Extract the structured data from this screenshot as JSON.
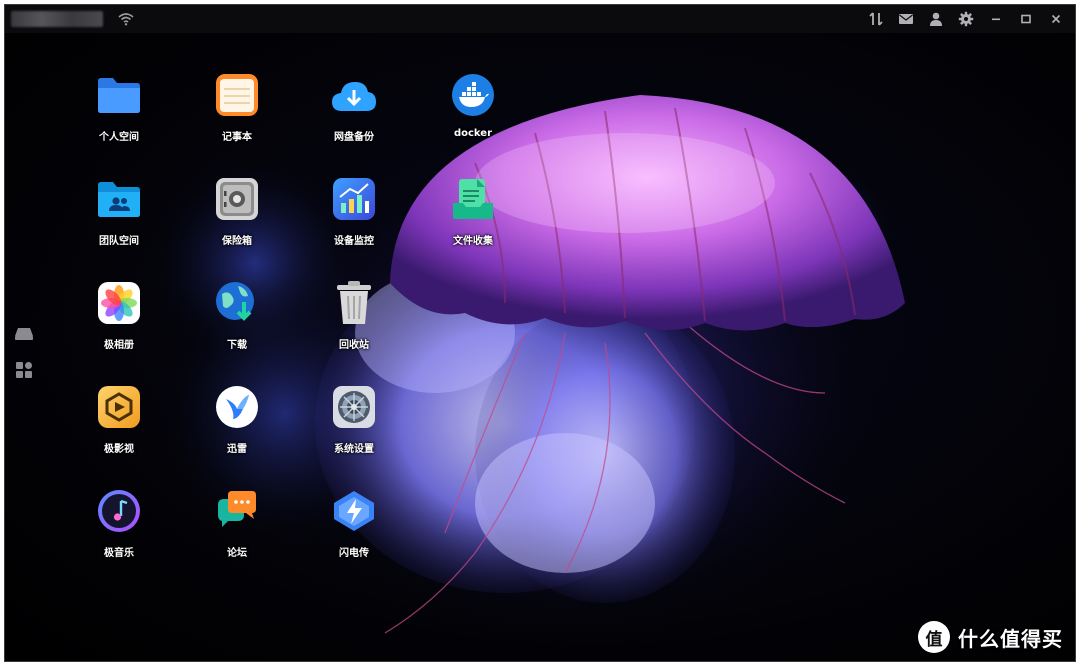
{
  "window": {
    "title": ""
  },
  "titlebar": {
    "icons": [
      "wifi-icon",
      "transfer-icon",
      "mail-icon",
      "user-icon",
      "settings-icon",
      "minimize-icon",
      "maximize-icon",
      "close-icon"
    ]
  },
  "sidebar": {
    "icons": [
      "drive-icon",
      "apps-grid-icon"
    ]
  },
  "apps": [
    {
      "label": "个人空间",
      "icon": "folder-icon",
      "color": "#3a8dff"
    },
    {
      "label": "记事本",
      "icon": "notepad-icon",
      "color": "#ff8a2a"
    },
    {
      "label": "网盘备份",
      "icon": "cloud-upload-icon",
      "color": "#2ea3ff"
    },
    {
      "label": "docker",
      "icon": "docker-icon",
      "color": "#1d7fe6"
    },
    {
      "label": "团队空间",
      "icon": "team-folder-icon",
      "color": "#1da1f2"
    },
    {
      "label": "保险箱",
      "icon": "safe-icon",
      "color": "#d9d9d9"
    },
    {
      "label": "设备监控",
      "icon": "monitor-chart-icon",
      "color": "#3b6cf6"
    },
    {
      "label": "文件收集",
      "icon": "file-collect-icon",
      "color": "#22c39a"
    },
    {
      "label": "极相册",
      "icon": "photos-icon",
      "color": "#ffffff"
    },
    {
      "label": "下载",
      "icon": "download-globe-icon",
      "color": "#1fb5a8"
    },
    {
      "label": "回收站",
      "icon": "trash-icon",
      "color": "#cfcfcf"
    },
    {
      "label": "极影视",
      "icon": "video-icon",
      "color": "#f4b23c"
    },
    {
      "label": "迅雷",
      "icon": "thunder-bird-icon",
      "color": "#ffffff"
    },
    {
      "label": "系统设置",
      "icon": "system-settings-icon",
      "color": "#8a9bb0"
    },
    {
      "label": "极音乐",
      "icon": "music-icon",
      "color": "#6a5cff"
    },
    {
      "label": "论坛",
      "icon": "forum-chat-icon",
      "color": "#ff8a2a"
    },
    {
      "label": "闪电传",
      "icon": "flash-transfer-icon",
      "color": "#3b82f6"
    }
  ],
  "watermark": {
    "text": "什么值得买",
    "logo": "值"
  }
}
